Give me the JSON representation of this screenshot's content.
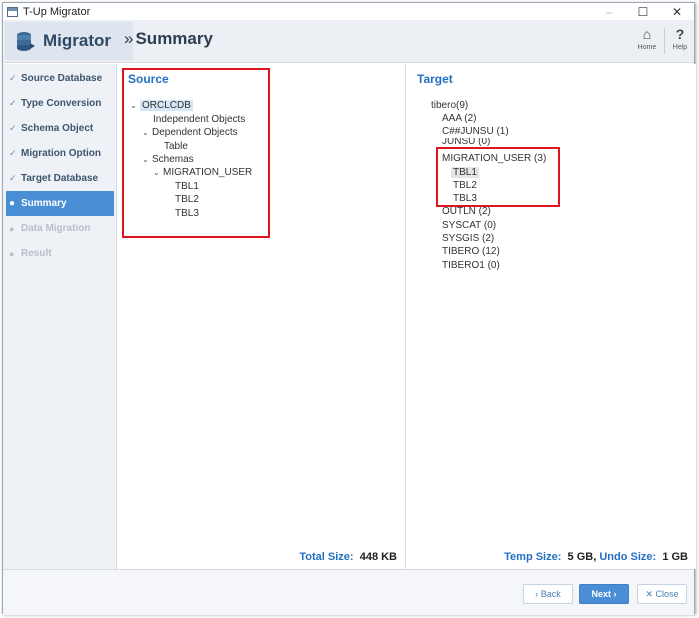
{
  "window": {
    "title": "T-Up Migrator",
    "controls": {
      "minimize": "–",
      "maximize": "☐",
      "close": "✕"
    }
  },
  "header": {
    "brand": "Migrator",
    "page_title": "Summary",
    "breadcrumb_glyph": "»",
    "home_label": "Home",
    "help_label": "Help",
    "home_glyph": "⌂",
    "help_glyph": "?"
  },
  "sidebar": {
    "items": [
      {
        "label": "Source Database",
        "state": "done",
        "mark": "✓"
      },
      {
        "label": "Type Conversion",
        "state": "done",
        "mark": "✓"
      },
      {
        "label": "Schema Object",
        "state": "done",
        "mark": "✓"
      },
      {
        "label": "Migration Option",
        "state": "done",
        "mark": "✓"
      },
      {
        "label": "Target Database",
        "state": "done",
        "mark": "✓"
      },
      {
        "label": "Summary",
        "state": "active",
        "mark": "●"
      },
      {
        "label": "Data Migration",
        "state": "pending",
        "mark": "●"
      },
      {
        "label": "Result",
        "state": "pending",
        "mark": "●"
      }
    ]
  },
  "source": {
    "title": "Source",
    "tree": [
      "ORCLCDB",
      "Independent Objects",
      "Dependent Objects",
      "Table",
      "Schemas",
      "MIGRATION_USER",
      "TBL1",
      "TBL2",
      "TBL3"
    ],
    "total_size_label": "Total Size:",
    "total_size_value": "448 KB"
  },
  "target": {
    "title": "Target",
    "tree": [
      "tibero(9)",
      "AAA (2)",
      "C##JUNSU (1)",
      "JUNSU (0)",
      "MIGRATION_USER (3)",
      "TBL1",
      "TBL2",
      "TBL3",
      "OUTLN (2)",
      "SYSCAT (0)",
      "SYSGIS (2)",
      "TIBERO (12)",
      "TIBERO1 (0)"
    ],
    "temp_size_label": "Temp Size:",
    "temp_size_value": "5 GB",
    "undo_size_label": "Undo Size:",
    "undo_size_value": "1 GB"
  },
  "footer": {
    "back_label": "‹ Back",
    "next_label": "Next ›",
    "close_label": "✕ Close"
  },
  "colors": {
    "accent": "#4a8fd6",
    "title_blue": "#2470c4",
    "highlight_red": "#e0141e"
  }
}
